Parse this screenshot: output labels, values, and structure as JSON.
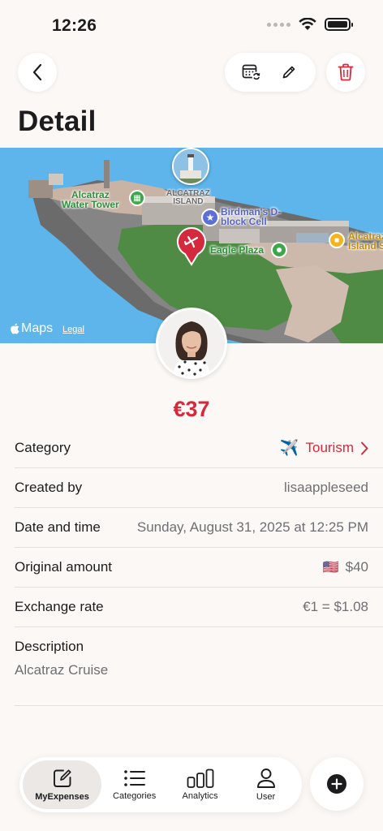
{
  "status_bar": {
    "time": "12:26"
  },
  "header": {
    "title": "Detail"
  },
  "map": {
    "labels": {
      "water_tower": "Alcatraz\nWater Tower",
      "island": "ALCATRAZ\nISLAND",
      "birdman": "Birdman's D-\nblock Cell",
      "eagle_plaza": "Eagle Plaza",
      "right_label": "Alcatraz\nIsland S"
    },
    "attribution": "Maps",
    "legal": "Legal"
  },
  "expense": {
    "amount": "€37",
    "rows": {
      "category": {
        "label": "Category",
        "emoji": "✈️",
        "value": "Tourism"
      },
      "created_by": {
        "label": "Created by",
        "value": "lisaappleseed"
      },
      "date_time": {
        "label": "Date and time",
        "value": "Sunday, August 31, 2025 at 12:25 PM"
      },
      "original_amount": {
        "label": "Original amount",
        "flag": "🇺🇸",
        "value": "$40"
      },
      "exchange_rate": {
        "label": "Exchange rate",
        "value": "€1 = $1.08"
      },
      "description": {
        "label": "Description",
        "value": "Alcatraz Cruise"
      }
    }
  },
  "tabbar": {
    "tabs": [
      {
        "label": "MyExpenses",
        "icon": "square-pencil-icon",
        "active": true
      },
      {
        "label": "Categories",
        "icon": "list-icon",
        "active": false
      },
      {
        "label": "Analytics",
        "icon": "bar-chart-icon",
        "active": false
      },
      {
        "label": "User",
        "icon": "person-icon",
        "active": false
      }
    ]
  },
  "colors": {
    "accent": "#d52a3d",
    "background": "#fcf8f5"
  }
}
